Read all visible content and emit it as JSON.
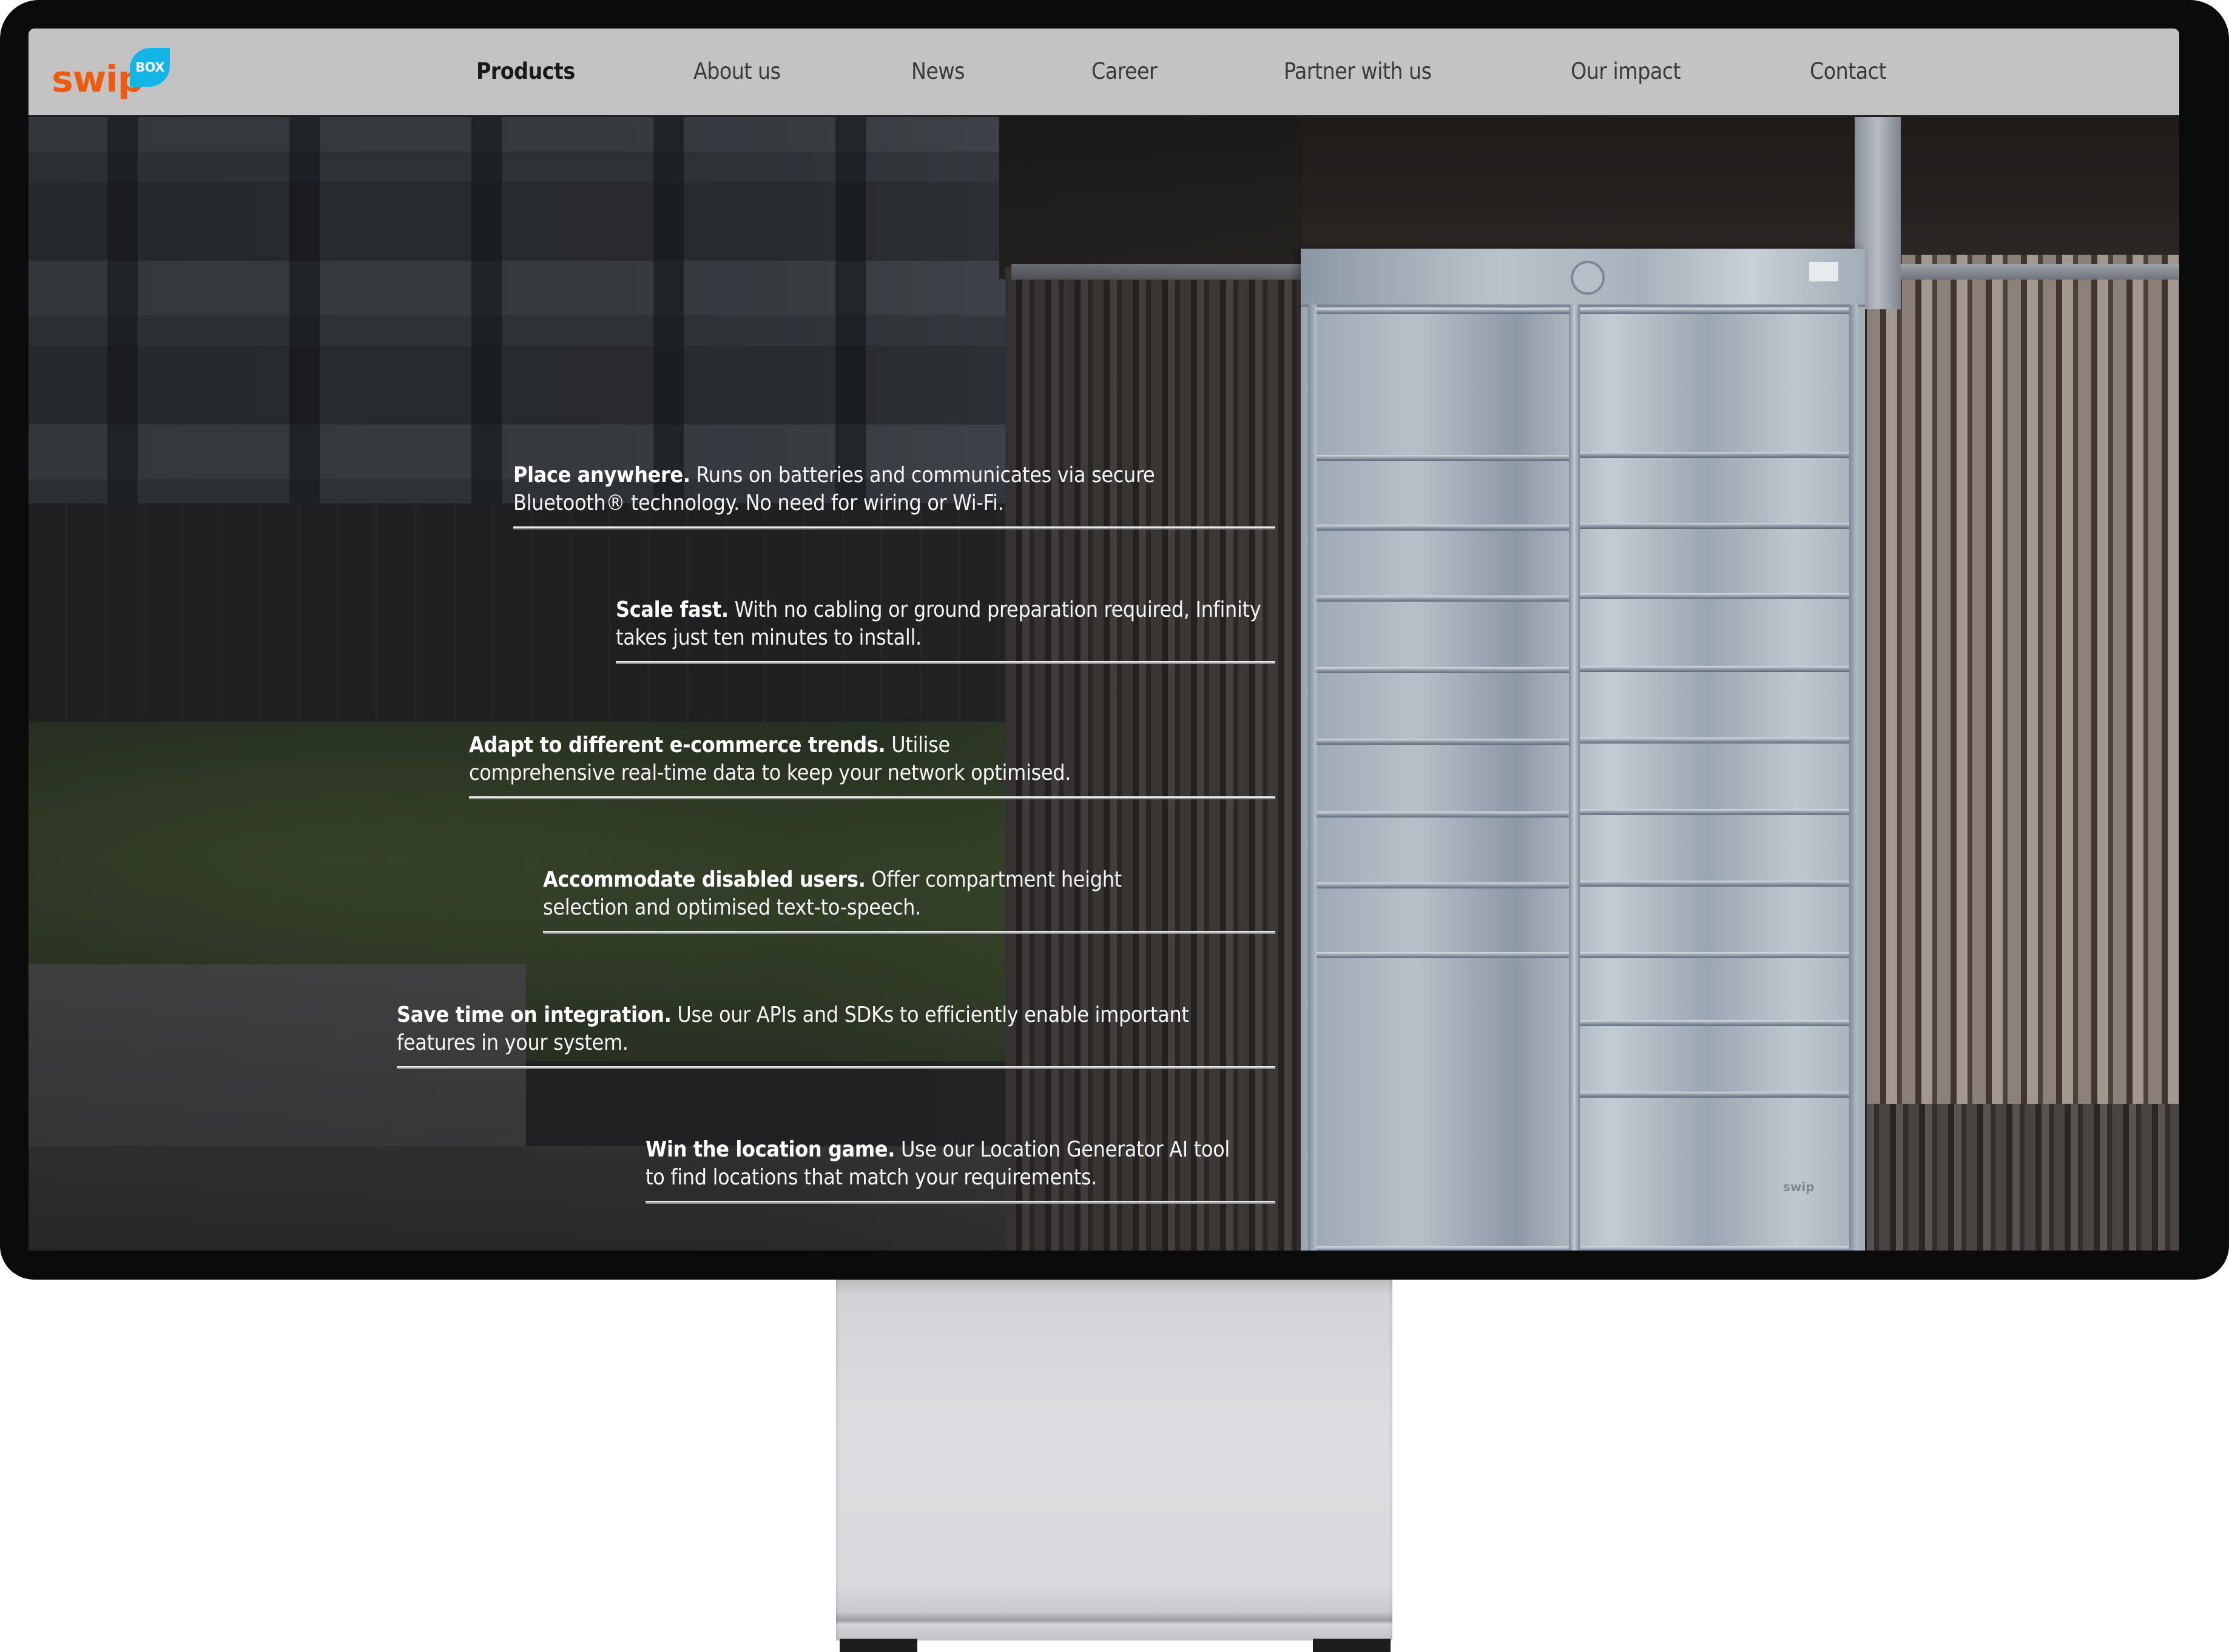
{
  "brand": {
    "logo_word": "swip",
    "logo_badge": "BOX",
    "colors": {
      "orange": "#ee5a12",
      "blue": "#13b5e6"
    }
  },
  "nav": {
    "items": [
      {
        "label": "Products",
        "active": true
      },
      {
        "label": "About us",
        "active": false
      },
      {
        "label": "News",
        "active": false
      },
      {
        "label": "Career",
        "active": false
      },
      {
        "label": "Partner with us",
        "active": false
      },
      {
        "label": "Our impact",
        "active": false
      },
      {
        "label": "Contact",
        "active": false
      }
    ]
  },
  "hero": {
    "image_subject": "Swipbox Infinity parcel locker in front of apartment building",
    "locker_brand": "swip"
  },
  "features": [
    {
      "title": "Place anywhere.",
      "body": "Runs on batteries and communicates via secure Bluetooth® technology. No need for wiring or Wi-Fi."
    },
    {
      "title": "Scale fast.",
      "body": "With no cabling or ground preparation required, Infinity takes just ten minutes to install."
    },
    {
      "title": "Adapt to different e-commerce trends.",
      "body": "Utilise comprehensive real-time data to keep your network optimised."
    },
    {
      "title": "Accommodate disabled users.",
      "body": "Offer compartment height selection and optimised text-to-speech."
    },
    {
      "title": "Save time on integration.",
      "body": "Use our APIs and SDKs to efficiently enable important features in your system."
    },
    {
      "title": "Win the location game.",
      "body": "Use our Location Generator AI tool to find locations that match your requirements."
    }
  ]
}
